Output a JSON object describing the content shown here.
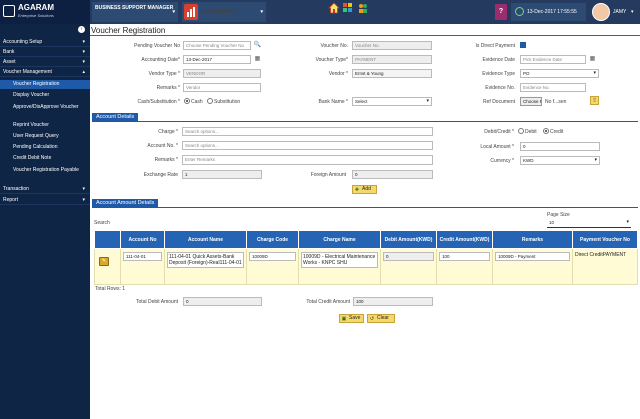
{
  "header": {
    "logo_name": "AGARAM",
    "logo_tagline": "Enterprise Solutions",
    "module_label": "BUSINESS SUPPORT MANAGER",
    "app_label": "ACCOUNTING",
    "help_label": "?",
    "datetime": "13-Dec-2017 17:55:55",
    "user_name": "JAMY",
    "chevron": "▾"
  },
  "sidebar": {
    "items": [
      {
        "label": "Accounting Setup"
      },
      {
        "label": "Bank"
      },
      {
        "label": "Asset"
      },
      {
        "label": "Voucher Management"
      }
    ],
    "sub_items": [
      {
        "label": "Voucher Registration"
      },
      {
        "label": "Display Voucher"
      },
      {
        "label": "Approve/DisApprove Voucher"
      },
      {
        "label": "Reprint Voucher"
      },
      {
        "label": "User Request Query"
      },
      {
        "label": "Pending Calculation"
      },
      {
        "label": "Credit Debit Note"
      },
      {
        "label": "Voucher Registration Payable"
      }
    ],
    "items_after": [
      {
        "label": "Transaction"
      },
      {
        "label": "Report"
      }
    ]
  },
  "page": {
    "title": "Voucher Registration"
  },
  "form": {
    "pending_voucher_no": {
      "label": "Pending Voucher No",
      "placeholder": "Choose Pending Voucher No"
    },
    "accounting_date": {
      "label": "Accounting Date*",
      "value": "13-Dec-2017"
    },
    "vendor_type": {
      "label": "Vendor Type *",
      "value": "VENDOR"
    },
    "remarks": {
      "label": "Remarks *",
      "value": "Vendor"
    },
    "cash_substitution": {
      "label": "Cash/Substitution *",
      "opt_cash": "Cash",
      "opt_substitution": "Substitution"
    },
    "voucher_no": {
      "label": "Voucher No.",
      "placeholder": "Voucher No."
    },
    "voucher_type": {
      "label": "Voucher Type*",
      "value": "PAYMENT"
    },
    "vendor": {
      "label": "Vendor *",
      "value": "Ernst & Young"
    },
    "bank_name": {
      "label": "Bank Name *",
      "value": "Select"
    },
    "is_direct_payment": {
      "label": "Is Direct Payment"
    },
    "evidence_date": {
      "label": "Evidence Date",
      "placeholder": "Pick Evidence Date"
    },
    "evidence_type": {
      "label": "Evidence Type",
      "value": "PO"
    },
    "evidence_no": {
      "label": "Evidence No.",
      "placeholder": "Evidence No."
    },
    "ref_document": {
      "label": "Ref Document",
      "button": "Choose File",
      "status": "No f...sen"
    }
  },
  "account_details": {
    "section_title": "Account Details",
    "charge": {
      "label": "Charge *",
      "placeholder": "Search options..."
    },
    "account_no": {
      "label": "Account No. *",
      "placeholder": "Search options..."
    },
    "remarks": {
      "label": "Remarks *",
      "placeholder": "Enter Remarks"
    },
    "exchange_rate": {
      "label": "Exchange Rate",
      "value": "1"
    },
    "foreign_amount": {
      "label": "Foreign Amount",
      "value": "0"
    },
    "debit_credit": {
      "label": "Debit/Credit *",
      "opt_debit": "Debit",
      "opt_credit": "Credit"
    },
    "local_amount": {
      "label": "Local Amount *",
      "value": "0"
    },
    "currency": {
      "label": "Currency *",
      "value": "KWD"
    },
    "add_button": "Add"
  },
  "amount_details": {
    "section_title": "Account Amount Details",
    "search_label": "Search",
    "page_size_label": "Page Size",
    "page_size_value": "10",
    "columns": [
      "",
      "Account No",
      "Account Name",
      "Charge Code",
      "Charge Name",
      "Debit Amount(KWD)",
      "Credit Amount(KWD)",
      "Remarks",
      "Payment Voucher No"
    ],
    "rows": [
      {
        "account_no": "111-04-01",
        "account_name": "111-04-01 Quick Assets-Bank Deposit (Foreign)-Real111-04-01",
        "charge_code": "10009D",
        "charge_name": "10009D - Electrical Maintenance Works - KNPC SHU",
        "debit": "0",
        "credit": "100",
        "remarks": "10009D - Payment",
        "payment_voucher_no": "Direct CreditPAYMENT"
      }
    ],
    "total_rows_label": "Total Rows: 1",
    "total_debit_label": "Total Debit Amount",
    "total_debit_value": "0",
    "total_credit_label": "Total Credit Amount",
    "total_credit_value": "100",
    "save_button": "Save",
    "clear_button": "Clear"
  }
}
